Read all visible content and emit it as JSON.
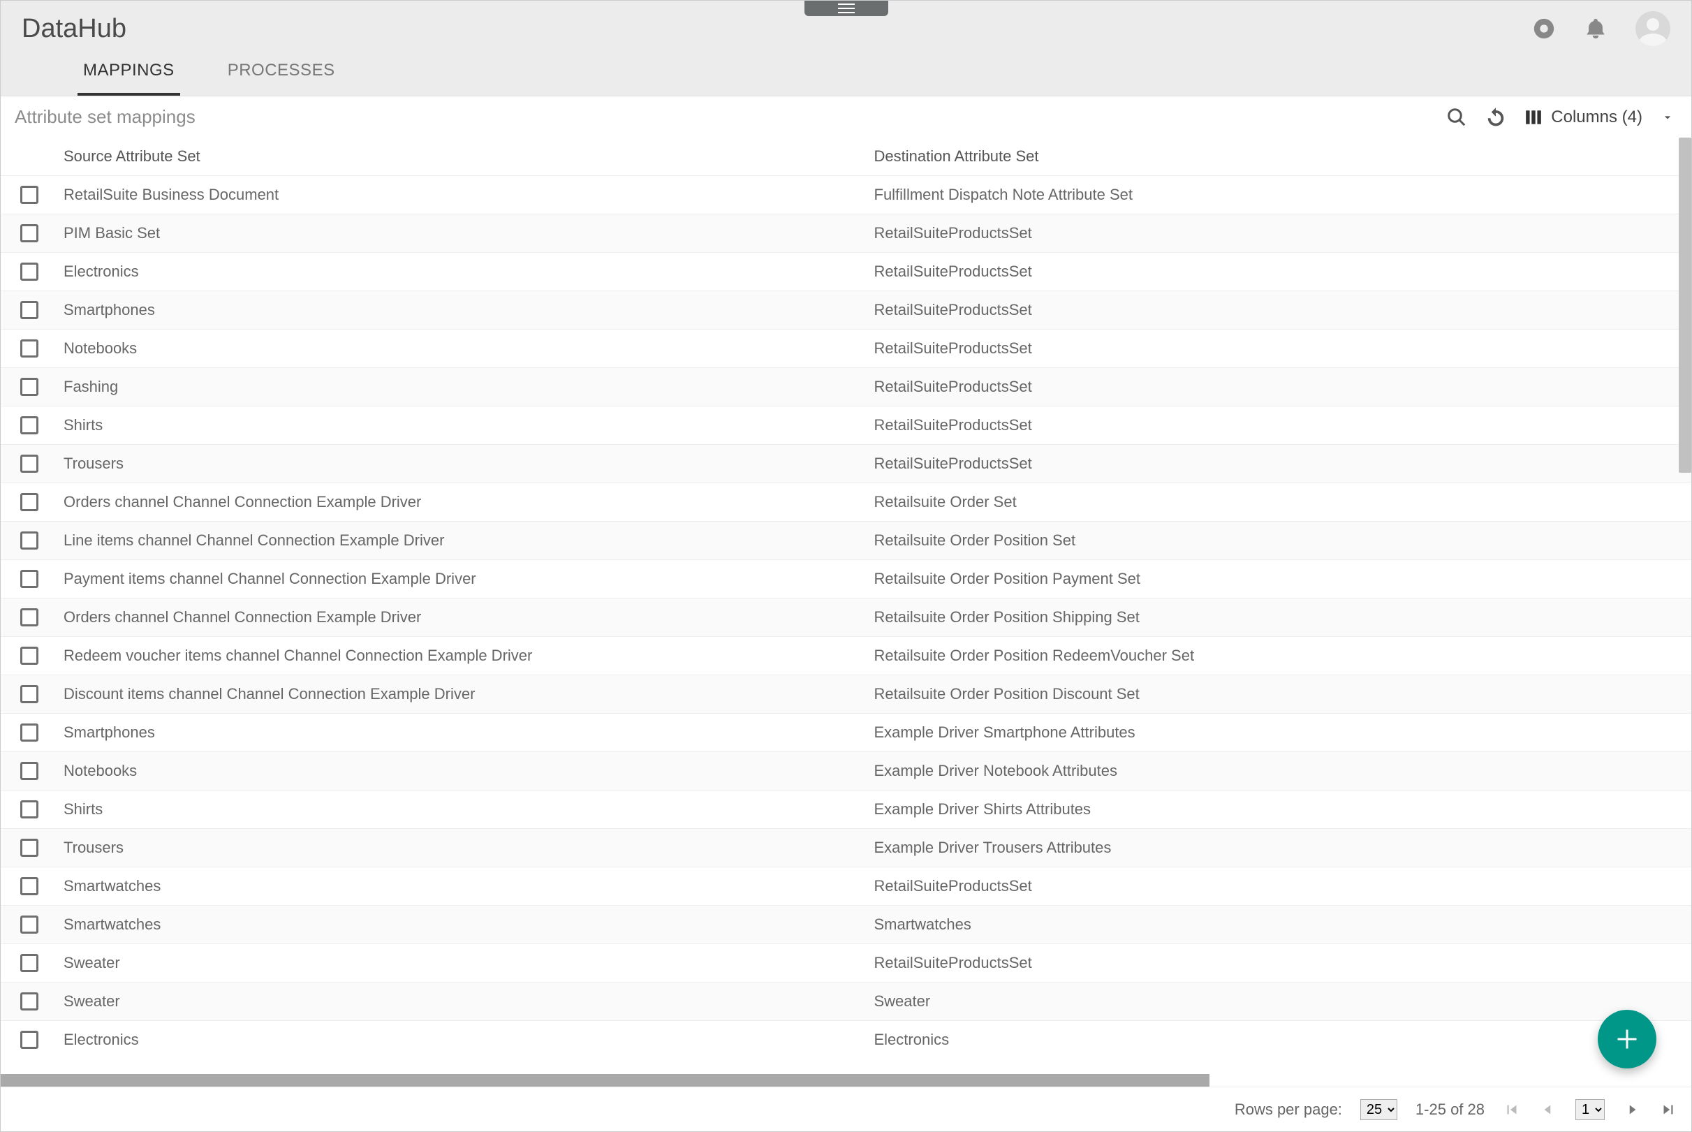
{
  "app": {
    "title": "DataHub"
  },
  "tabs": {
    "active": 0,
    "items": [
      "MAPPINGS",
      "PROCESSES"
    ]
  },
  "toolbar": {
    "title": "Attribute set mappings",
    "columns_label": "Columns (4)"
  },
  "table": {
    "headers": {
      "source": "Source Attribute Set",
      "destination": "Destination Attribute Set"
    },
    "rows": [
      {
        "source": "RetailSuite Business Document",
        "destination": "Fulfillment Dispatch Note Attribute Set"
      },
      {
        "source": "PIM Basic Set",
        "destination": "RetailSuiteProductsSet"
      },
      {
        "source": "Electronics",
        "destination": "RetailSuiteProductsSet"
      },
      {
        "source": "Smartphones",
        "destination": "RetailSuiteProductsSet"
      },
      {
        "source": "Notebooks",
        "destination": "RetailSuiteProductsSet"
      },
      {
        "source": "Fashing",
        "destination": "RetailSuiteProductsSet"
      },
      {
        "source": "Shirts",
        "destination": "RetailSuiteProductsSet"
      },
      {
        "source": "Trousers",
        "destination": "RetailSuiteProductsSet"
      },
      {
        "source": "Orders channel Channel Connection Example Driver",
        "destination": "Retailsuite Order Set"
      },
      {
        "source": "Line items channel Channel Connection Example Driver",
        "destination": "Retailsuite Order Position Set"
      },
      {
        "source": "Payment items channel Channel Connection Example Driver",
        "destination": "Retailsuite Order Position Payment Set"
      },
      {
        "source": "Orders channel Channel Connection Example Driver",
        "destination": "Retailsuite Order Position Shipping Set"
      },
      {
        "source": "Redeem voucher items channel Channel Connection Example Driver",
        "destination": "Retailsuite Order Position RedeemVoucher Set"
      },
      {
        "source": "Discount items channel Channel Connection Example Driver",
        "destination": "Retailsuite Order Position Discount Set"
      },
      {
        "source": "Smartphones",
        "destination": "Example Driver Smartphone Attributes"
      },
      {
        "source": "Notebooks",
        "destination": "Example Driver Notebook Attributes"
      },
      {
        "source": "Shirts",
        "destination": "Example Driver Shirts Attributes"
      },
      {
        "source": "Trousers",
        "destination": "Example Driver Trousers Attributes"
      },
      {
        "source": "Smartwatches",
        "destination": "RetailSuiteProductsSet"
      },
      {
        "source": "Smartwatches",
        "destination": "Smartwatches"
      },
      {
        "source": "Sweater",
        "destination": "RetailSuiteProductsSet"
      },
      {
        "source": "Sweater",
        "destination": "Sweater"
      },
      {
        "source": "Electronics",
        "destination": "Electronics"
      }
    ]
  },
  "footer": {
    "rows_per_page_label": "Rows per page:",
    "rows_per_page_value": "25",
    "rows_per_page_options": [
      "25"
    ],
    "range_text": "1-25 of 28",
    "page_value": "1",
    "page_options": [
      "1"
    ]
  }
}
